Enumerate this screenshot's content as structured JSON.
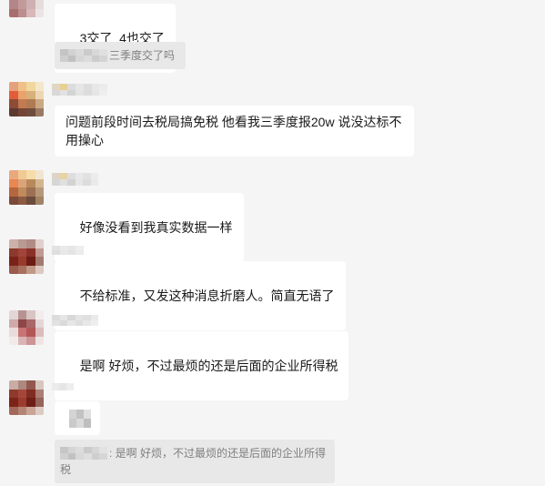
{
  "colors": {
    "background": "#f5f5f5",
    "bubble": "#ffffff",
    "quote_background": "#e8e8e8",
    "quote_text": "#7f7f7f",
    "message_text": "#191919"
  },
  "messages": [
    {
      "avatar_mosaic": [
        [
          "#b4868a",
          "#c29a9a",
          "#cfb0b0",
          "#e6dcdc"
        ],
        [
          "#a86e6e",
          "#bc8e8e",
          "#d8b8b8",
          "#ece4e4"
        ]
      ],
      "text": "3交了  4也交了",
      "reply_quote": {
        "sender_mosaic": [
          [
            "#c4c4c4",
            "#d2d2d2",
            "#dadada",
            "#cacaca",
            "#d8d8d8",
            "#e0e0e0"
          ],
          [
            "#cecece",
            "#c0c0c0",
            "#d6d6d6",
            "#dcdcdc",
            "#cccccc",
            "#d4d4d4"
          ]
        ],
        "text": "三季度交了吗"
      }
    },
    {
      "avatar_mosaic": [
        [
          "#e4a27c",
          "#f1c087",
          "#efd79e",
          "#f5e6c9"
        ],
        [
          "#e35c3a",
          "#e9a26c",
          "#d7b07a",
          "#ecd6b4"
        ],
        [
          "#8e4b36",
          "#c27a52",
          "#b07a52",
          "#c9a882"
        ],
        [
          "#5b3a32",
          "#744536",
          "#6e4d3d",
          "#9a7a62"
        ]
      ],
      "sender_mosaic": [
        [
          "#e0d6c4",
          "#e8cf94",
          "#dcdcdc",
          "#e6e6e6",
          "#dedede",
          "#e8e8e8",
          "#ececec"
        ],
        [
          "#d8d8d8",
          "#e2e2e2",
          "#d4d4d4",
          "#e4e4e4",
          "#dcdcdc",
          "#e6e6e6",
          "#eeeeee"
        ]
      ],
      "text": "问题前段时间去税局搞免税 他看我三季度报20w 说没达标不用操心"
    },
    {
      "avatar_mosaic": [
        [
          "#e9a97d",
          "#f0c993",
          "#f5dca9",
          "#f1e5cf"
        ],
        [
          "#e98652",
          "#dca37a",
          "#b8895a",
          "#d2b58e"
        ],
        [
          "#b6663e",
          "#c08a5c",
          "#9c7052",
          "#b7977a"
        ],
        [
          "#7c4a38",
          "#8c5a42",
          "#6b4c3c",
          "#a28366"
        ]
      ],
      "sender_mosaic": [
        [
          "#ddd4c6",
          "#e6d3a6",
          "#dedede",
          "#e8e8e8",
          "#e2e2e2",
          "#ececec"
        ],
        [
          "#d6d6d6",
          "#e0e0e0",
          "#d2d2d2",
          "#e6e6e6",
          "#dcdcdc",
          "#eaeaea"
        ]
      ],
      "text": "好像没看到我真实数据一样"
    },
    {
      "avatar_mosaic": [
        [
          "#cdb0a8",
          "#b89a92",
          "#b08c84",
          "#e0d0ca"
        ],
        [
          "#8c3a2e",
          "#a2443a",
          "#8a3028",
          "#c09a92"
        ],
        [
          "#7a2219",
          "#983a2c",
          "#6c1c14",
          "#a47a70"
        ],
        [
          "#9a5a4c",
          "#a8705e",
          "#c09888",
          "#dcc8c0"
        ]
      ],
      "sender_mosaic": [
        [
          "#e2e2e2",
          "#eaeaea",
          "#e6e6e6",
          "#eeeeee"
        ],
        [
          "#dedede",
          "#e8e8e8",
          "#e4e4e4",
          "#ececec"
        ]
      ],
      "text": "不给标准，又发这种消息折磨人。简直无语了"
    },
    {
      "avatar_mosaic": [
        [
          "#e2d6d6",
          "#b89292",
          "#d9c4c4",
          "#f2ecec"
        ],
        [
          "#cfaaaa",
          "#8e4646",
          "#a86868",
          "#e4d6d6"
        ],
        [
          "#ebdcdc",
          "#c87474",
          "#b45656",
          "#dcbcbc"
        ],
        [
          "#f2eaea",
          "#dab4b4",
          "#cc9494",
          "#eee4e4"
        ]
      ],
      "sender_mosaic": [
        [
          "#dcdcdc",
          "#e6e6e6",
          "#d8d8d8",
          "#e4e4e4",
          "#e0e0e0",
          "#eaeaea"
        ],
        [
          "#e2e2e2",
          "#dadada",
          "#e6e6e6",
          "#dedede",
          "#e8e8e8",
          "#eeeeee"
        ]
      ],
      "text": "是啊 好烦，不过最烦的还是后面的企业所得税"
    },
    {
      "avatar_mosaic": [
        [
          "#c9aca4",
          "#ac8880",
          "#92584e",
          "#d6c6be"
        ],
        [
          "#8e3a2e",
          "#a6463a",
          "#802c22",
          "#aa7e74"
        ],
        [
          "#7c2418",
          "#9c3c2e",
          "#6e1e16",
          "#946458"
        ],
        [
          "#a4685a",
          "#b48474",
          "#caa496",
          "#dccbc2"
        ]
      ],
      "sender_mosaic": [
        [
          "#ebebeb",
          "#e6e6e6",
          "#eeeeee"
        ]
      ],
      "image_mosaic": [
        [
          "#d4d4d4",
          "#c2c2c2",
          "#e0e0e0"
        ],
        [
          "#cacaca",
          "#dadada",
          "#bebebe"
        ]
      ],
      "reply_quote": {
        "sender_mosaic": [
          [
            "#c6c6c6",
            "#d4d4d4",
            "#dcdcdc",
            "#cacaca",
            "#d6d6d6",
            "#e2e2e2"
          ],
          [
            "#d0d0d0",
            "#c2c2c2",
            "#d8d8d8",
            "#dedede",
            "#cecece",
            "#d6d6d6"
          ]
        ],
        "text": ": 是啊 好烦，不过最烦的还是后面的企业所得税"
      }
    }
  ]
}
